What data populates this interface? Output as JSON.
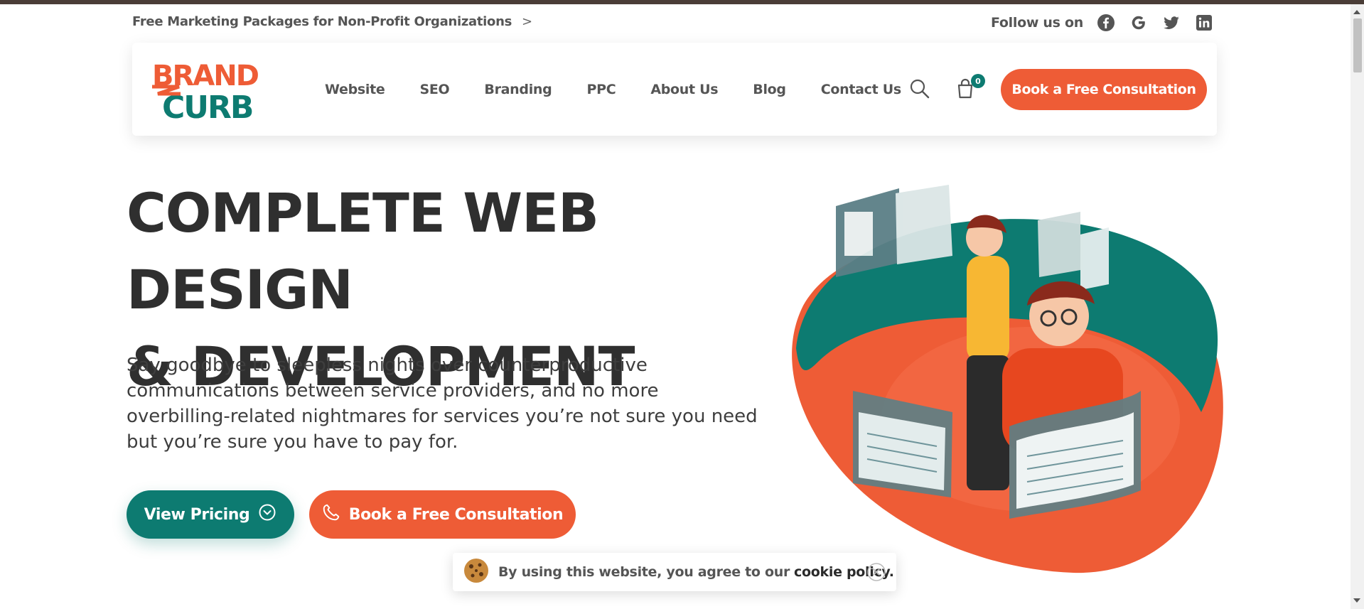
{
  "announcement": {
    "text": "Free Marketing Packages for Non-Profit Organizations",
    "chevron": ">"
  },
  "social": {
    "label": "Follow us on",
    "icons": [
      "facebook-icon",
      "google-icon",
      "twitter-icon",
      "linkedin-icon"
    ]
  },
  "header": {
    "logo_top": "BRAND",
    "logo_bottom": "CURB",
    "nav": [
      "Website",
      "SEO",
      "Branding",
      "PPC",
      "About Us",
      "Blog",
      "Contact Us"
    ],
    "cart_count": "0",
    "cta": "Book a Free Consultation"
  },
  "hero": {
    "title_line1": "COMPLETE WEB DESIGN",
    "title_line2": "& DEVELOPMENT",
    "description": "Say goodbye to sleepless nights over counterproductive communications between service providers, and no more overbilling-related nightmares for services you’re not sure you need but you’re sure you have to pay for.",
    "btn_pricing": "View Pricing",
    "btn_consult": "Book a Free Consultation"
  },
  "cookie": {
    "text": "By using this website, you agree to our",
    "link": "cookie policy."
  },
  "colors": {
    "brand_orange": "#ee5c36",
    "brand_teal": "#0d7b71",
    "text_dark": "#2f2f2f"
  }
}
